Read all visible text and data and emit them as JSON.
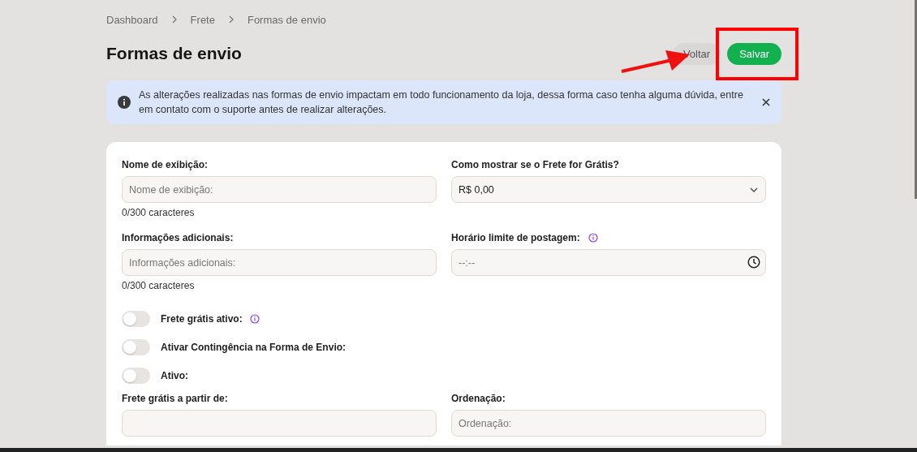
{
  "breadcrumb": [
    {
      "label": "Dashboard"
    },
    {
      "label": "Frete"
    },
    {
      "label": "Formas de envio"
    }
  ],
  "page_title": "Formas de envio",
  "buttons": [
    {
      "label": "Voltar",
      "kind": "secondary"
    },
    {
      "label": "Salvar",
      "kind": "primary"
    }
  ],
  "alert": {
    "text": "As alterações realizadas nas formas de envio impactam em todo funcionamento da loja, dessa forma caso tenha alguma dúvida, entre em contato com o suporte antes de realizar alterações."
  },
  "form": {
    "rows": [
      {
        "fields": [
          {
            "kind": "text",
            "label": "Nome de exibição:",
            "placeholder": "Nome de exibição:",
            "counter": "0/300 caracteres"
          },
          {
            "kind": "select",
            "label": "Como mostrar se o Frete for Grátis?",
            "value": "R$ 0,00"
          }
        ]
      },
      {
        "fields": [
          {
            "kind": "text",
            "label": "Informações adicionais:",
            "placeholder": "Informações adicionais:",
            "counter": "0/300 caracteres"
          },
          {
            "kind": "time",
            "label": "Horário limite de postagem:",
            "placeholder": "--:--",
            "info": true
          }
        ]
      }
    ],
    "toggles": [
      {
        "label": "Frete grátis ativo:",
        "on": false,
        "info": true
      },
      {
        "label": "Ativar Contingência na Forma de Envio:",
        "on": false,
        "info": false
      },
      {
        "label": "Ativo:",
        "on": false,
        "info": false
      }
    ],
    "rows_after": [
      {
        "fields": [
          {
            "kind": "text",
            "label": "Frete grátis a partir de:"
          },
          {
            "kind": "text",
            "label": "Ordenação:",
            "placeholder": "Ordenação:"
          }
        ]
      }
    ]
  }
}
